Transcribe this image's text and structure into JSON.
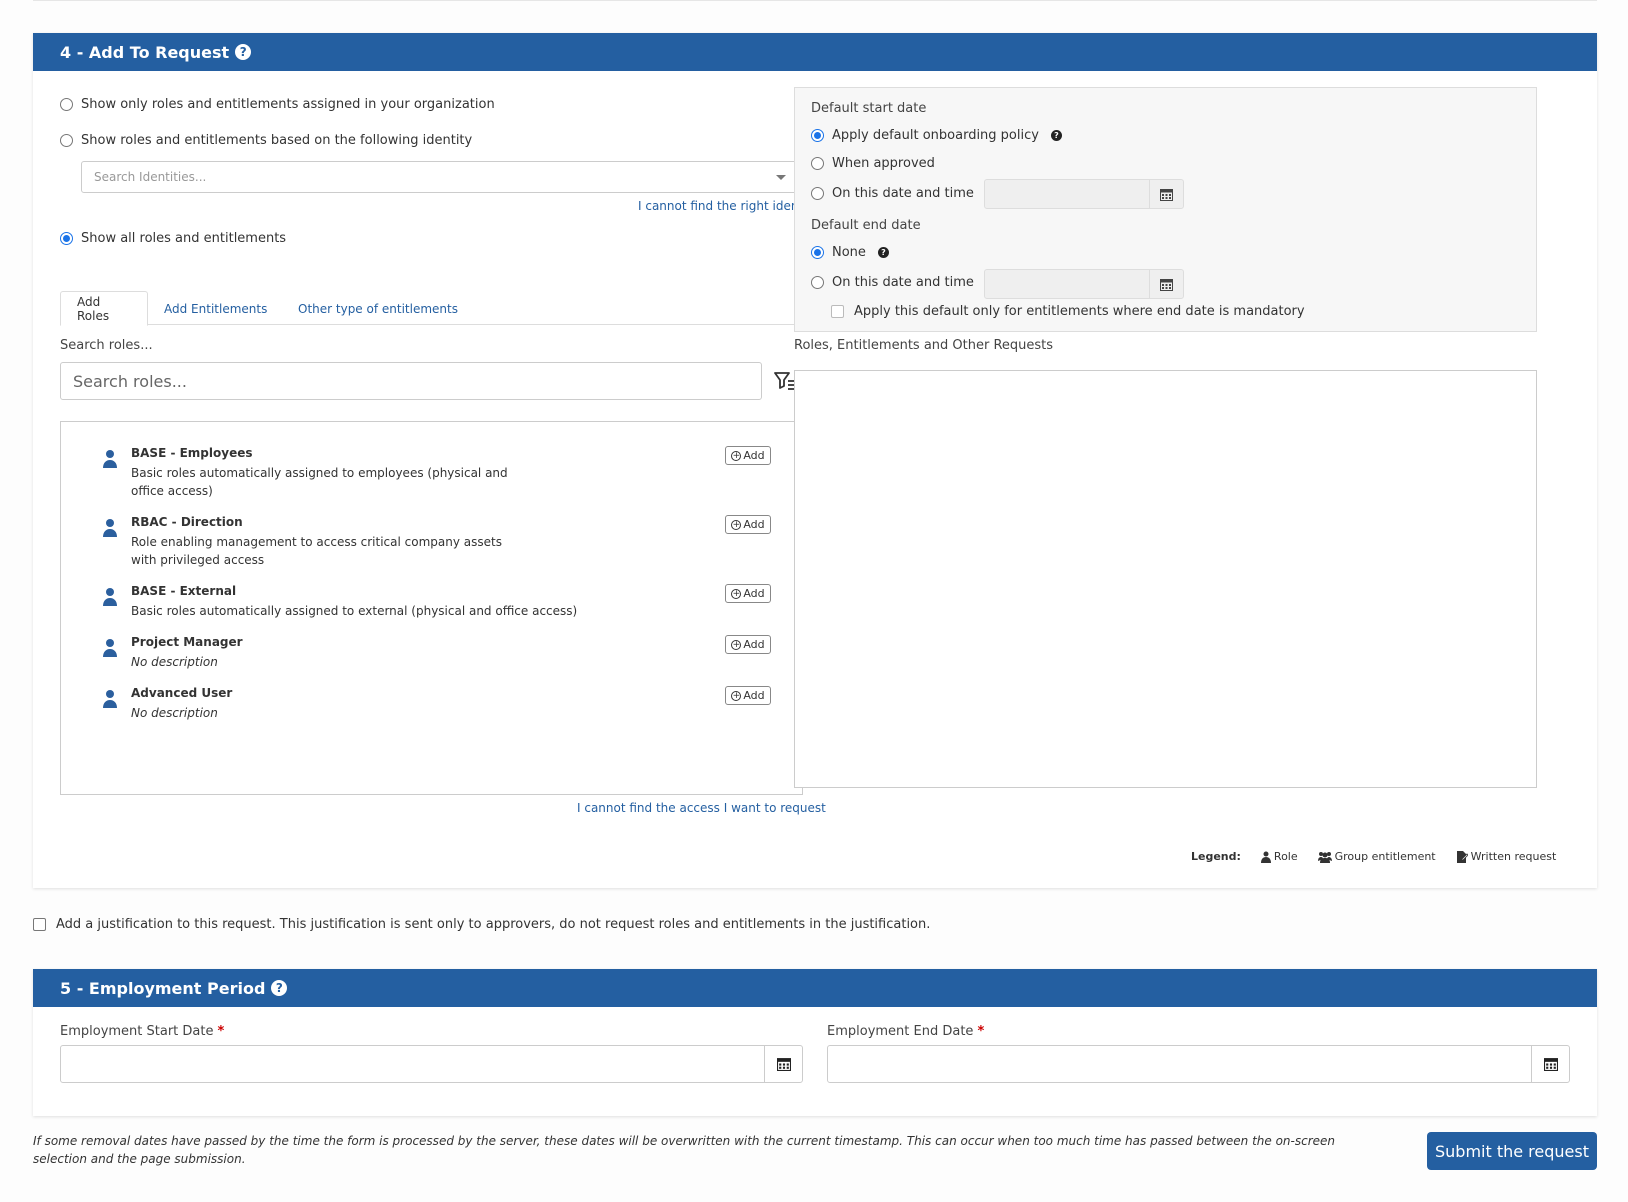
{
  "section4": {
    "title": "4 - Add To Request",
    "help": "?",
    "filters": {
      "only_org": "Show only roles and entitlements assigned in your organization",
      "by_identity": "Show roles and entitlements based on the following identity",
      "identity_placeholder": "Search Identities...",
      "cannot_find_identity": "I cannot find the right identity",
      "show_all": "Show all roles and entitlements"
    },
    "tabs": [
      "Add Roles",
      "Add Entitlements",
      "Other type of entitlements"
    ],
    "search_label": "Search roles...",
    "search_placeholder": "Search roles...",
    "add_label": "Add",
    "roles": [
      {
        "name": "BASE - Employees",
        "description": "Basic roles automatically assigned to employees (physical and office access)"
      },
      {
        "name": "RBAC - Direction",
        "description": "Role enabling management to access critical company assets with privileged access"
      },
      {
        "name": "BASE - External",
        "description": "Basic roles automatically assigned to external (physical and office access)"
      },
      {
        "name": "Project Manager",
        "description": "No description"
      },
      {
        "name": "Advanced User",
        "description": "No description"
      }
    ],
    "cannot_find_access": "I cannot find the access I want to request",
    "defaults": {
      "start_label": "Default start date",
      "apply_default": "Apply default onboarding policy",
      "when_approved": "When approved",
      "on_date": "On this date and time",
      "end_label": "Default end date",
      "none": "None",
      "on_date_end": "On this date and time",
      "mandatory_only": "Apply this default only for entitlements where end date is mandatory"
    },
    "requests_label": "Roles, Entitlements and Other Requests",
    "legend": {
      "label": "Legend:",
      "role": "Role",
      "group": "Group entitlement",
      "written": "Written request"
    }
  },
  "justification": "Add a justification to this request. This justification is sent only to approvers, do not request roles and entitlements in the justification.",
  "section5": {
    "title": "5 - Employment Period",
    "help": "?",
    "start_label": "Employment Start Date",
    "end_label": "Employment End Date",
    "required_mark": "*"
  },
  "notice": "If some removal dates have passed by the time the form is processed by the server, these dates will be overwritten with the current timestamp. This can occur when too much time has passed between the on-screen selection and the page submission.",
  "submit_label": "Submit the request",
  "colors": {
    "header": "#245fa1",
    "link": "#245fa1",
    "radio_on": "#1a73e8"
  }
}
